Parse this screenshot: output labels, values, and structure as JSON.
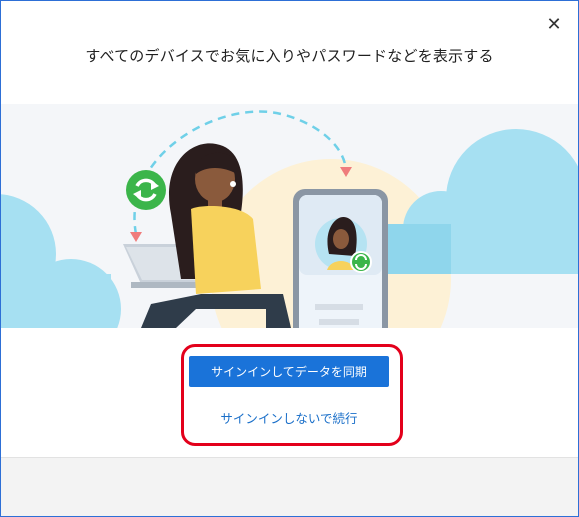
{
  "dialog": {
    "title": "すべてのデバイスでお気に入りやパスワードなどを表示する",
    "close_icon": "close-icon"
  },
  "actions": {
    "primary_label": "サインインしてデータを同期",
    "secondary_label": "サインインしないで続行"
  },
  "colors": {
    "accent": "#1a73d9",
    "link": "#1a6fc9",
    "highlight": "#e3001b",
    "sync_green": "#3bb54a",
    "cloud": "#a6e0f2"
  }
}
